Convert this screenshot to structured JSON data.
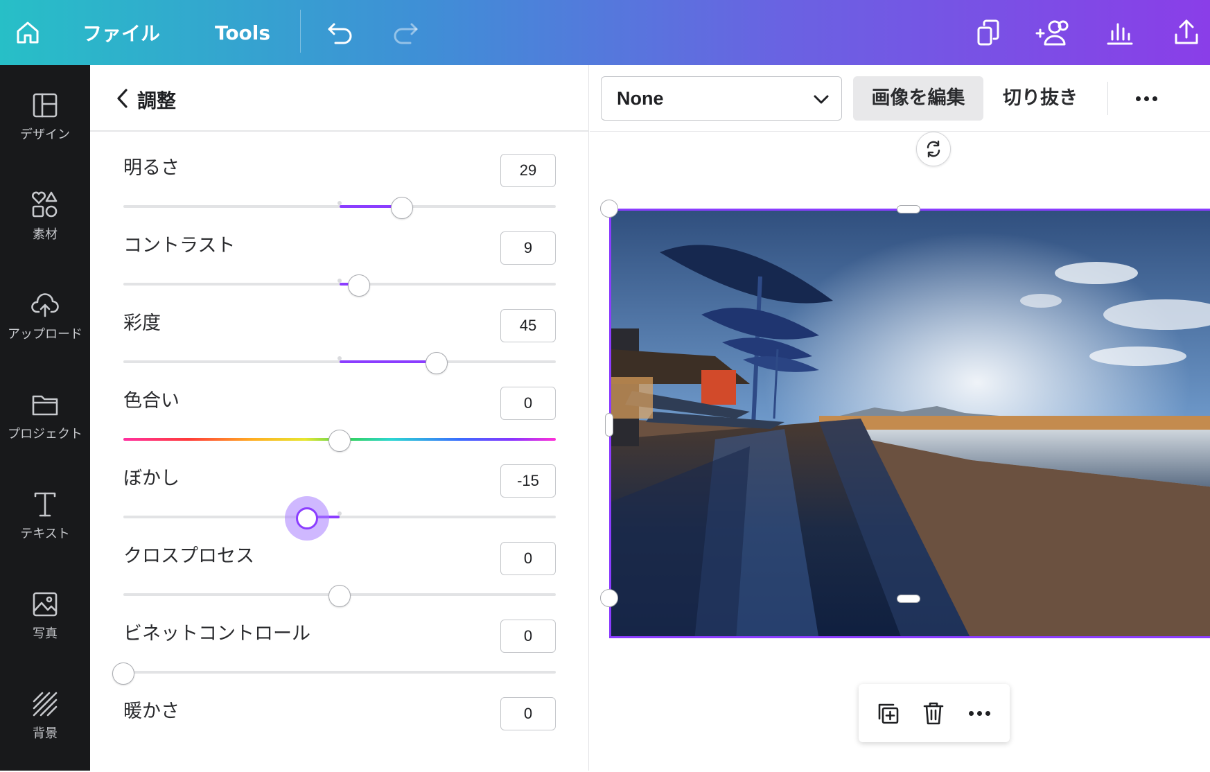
{
  "topbar": {
    "file_label": "ファイル",
    "tools_label": "Tools",
    "icons": [
      "home-icon",
      "undo-icon",
      "redo-icon",
      "resize-icon",
      "share-people-icon",
      "insights-icon",
      "upload-share-icon"
    ]
  },
  "sidebar": {
    "items": [
      {
        "label": "デザイン",
        "icon": "layout-icon"
      },
      {
        "label": "素材",
        "icon": "elements-icon"
      },
      {
        "label": "アップロード",
        "icon": "cloud-upload-icon"
      },
      {
        "label": "プロジェクト",
        "icon": "folder-icon"
      },
      {
        "label": "テキスト",
        "icon": "text-icon"
      },
      {
        "label": "写真",
        "icon": "photo-icon"
      },
      {
        "label": "背景",
        "icon": "background-icon"
      }
    ]
  },
  "panel": {
    "title": "調整",
    "adjustments": [
      {
        "label": "明るさ",
        "value": "29"
      },
      {
        "label": "コントラスト",
        "value": "9"
      },
      {
        "label": "彩度",
        "value": "45"
      },
      {
        "label": "色合い",
        "value": "0"
      },
      {
        "label": "ぼかし",
        "value": "-15"
      },
      {
        "label": "クロスプロセス",
        "value": "0"
      },
      {
        "label": "ビネットコントロール",
        "value": "0"
      },
      {
        "label": "暖かさ",
        "value": "0"
      }
    ]
  },
  "context_toolbar": {
    "filter_value": "None",
    "edit_image_label": "画像を編集",
    "crop_label": "切り抜き"
  },
  "colors": {
    "accent": "#8b3dff",
    "rail_bg": "#18191b",
    "gradient_start": "#27bfc7",
    "gradient_end": "#8a3ee8"
  }
}
